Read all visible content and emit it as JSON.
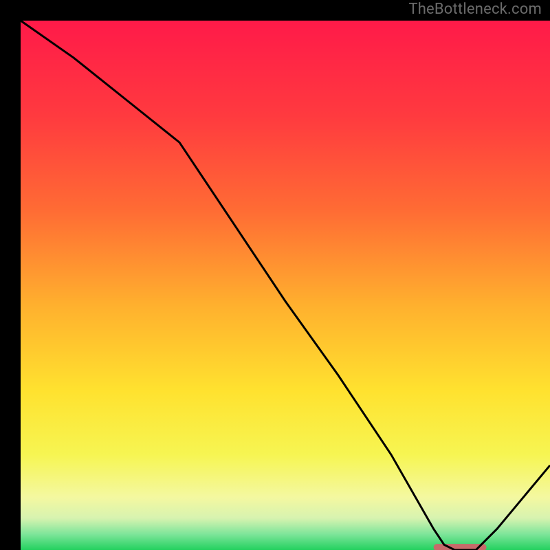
{
  "watermark": "TheBottleneck.com",
  "chart_data": {
    "type": "line",
    "title": "",
    "xlabel": "",
    "ylabel": "",
    "x_range": [
      0,
      100
    ],
    "y_range": [
      0,
      100
    ],
    "series": [
      {
        "name": "curve",
        "x": [
          0,
          10,
          20,
          30,
          40,
          50,
          60,
          70,
          78,
          80,
          82,
          86,
          90,
          100
        ],
        "y": [
          100,
          93,
          85,
          77,
          62,
          47,
          33,
          18,
          4,
          1,
          0,
          0,
          4,
          16
        ]
      }
    ],
    "marker": {
      "name": "flat-segment",
      "x_start": 78,
      "x_end": 88,
      "y": 0.5
    },
    "background_gradient": {
      "stops": [
        {
          "offset": 0.0,
          "color": "#ff1a49"
        },
        {
          "offset": 0.18,
          "color": "#ff3a3f"
        },
        {
          "offset": 0.36,
          "color": "#ff6c34"
        },
        {
          "offset": 0.54,
          "color": "#ffb12e"
        },
        {
          "offset": 0.7,
          "color": "#ffe22f"
        },
        {
          "offset": 0.82,
          "color": "#f6f552"
        },
        {
          "offset": 0.9,
          "color": "#f4f8a0"
        },
        {
          "offset": 0.94,
          "color": "#d7f3b0"
        },
        {
          "offset": 0.97,
          "color": "#7ee59a"
        },
        {
          "offset": 1.0,
          "color": "#23d15f"
        }
      ]
    },
    "colors": {
      "curve": "#000000",
      "marker": "#c76a6a",
      "frame": "#000000"
    }
  }
}
